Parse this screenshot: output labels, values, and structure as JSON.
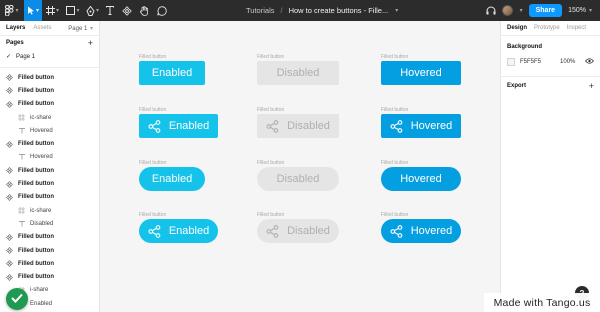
{
  "toolbar": {
    "breadcrumb_project": "Tutorials",
    "breadcrumb_sep": "/",
    "file_title": "How to create buttons - Fille...",
    "share_label": "Share",
    "zoom_label": "150%",
    "icons": [
      "figma-menu-icon",
      "move-tool-icon",
      "frame-tool-icon",
      "shape-tool-icon",
      "pen-tool-icon",
      "text-tool-icon",
      "component-tool-icon",
      "hand-tool-icon",
      "comment-tool-icon",
      "headphones-icon",
      "avatar",
      "share-button",
      "zoom-menu"
    ]
  },
  "left_panel": {
    "tab_layers": "Layers",
    "tab_assets": "Assets",
    "page_menu": "Page 1",
    "pages_title": "Pages",
    "add_symbol": "+",
    "current_page": "Page 1",
    "check_symbol": "✓",
    "layers": [
      {
        "label": "Filled button",
        "kind": "component"
      },
      {
        "label": "Filled button",
        "kind": "component"
      },
      {
        "label": "Filled button",
        "kind": "component"
      },
      {
        "label": "ic-share",
        "kind": "child-grid"
      },
      {
        "label": "Hovered",
        "kind": "child-text"
      },
      {
        "label": "Filled button",
        "kind": "component"
      },
      {
        "label": "Hovered",
        "kind": "child-text"
      },
      {
        "label": "Filled button",
        "kind": "component"
      },
      {
        "label": "Filled button",
        "kind": "component"
      },
      {
        "label": "Filled button",
        "kind": "component"
      },
      {
        "label": "ic-share",
        "kind": "child-grid"
      },
      {
        "label": "Disabled",
        "kind": "child-text"
      },
      {
        "label": "Filled button",
        "kind": "component"
      },
      {
        "label": "Filled button",
        "kind": "component"
      },
      {
        "label": "Filled button",
        "kind": "component"
      },
      {
        "label": "Filled button",
        "kind": "component"
      },
      {
        "label": "i-share",
        "kind": "child-grid"
      },
      {
        "label": "Enabled",
        "kind": "child-text"
      }
    ]
  },
  "canvas": {
    "frame_label": "Filled button",
    "buttons": [
      {
        "label": "Enabled",
        "state": "enabled",
        "icon": false,
        "shape": "rect"
      },
      {
        "label": "Disabled",
        "state": "disabled",
        "icon": false,
        "shape": "rect"
      },
      {
        "label": "Hovered",
        "state": "hovered",
        "icon": false,
        "shape": "rect"
      },
      {
        "label": "Enabled",
        "state": "enabled",
        "icon": true,
        "shape": "rect"
      },
      {
        "label": "Disabled",
        "state": "disabled",
        "icon": true,
        "shape": "rect"
      },
      {
        "label": "Hovered",
        "state": "hovered",
        "icon": true,
        "shape": "rect"
      },
      {
        "label": "Enabled",
        "state": "enabled",
        "icon": false,
        "shape": "pill"
      },
      {
        "label": "Disabled",
        "state": "disabled",
        "icon": false,
        "shape": "pill"
      },
      {
        "label": "Hovered",
        "state": "hovered",
        "icon": false,
        "shape": "pill"
      },
      {
        "label": "Enabled",
        "state": "enabled",
        "icon": true,
        "shape": "pill"
      },
      {
        "label": "Disabled",
        "state": "disabled",
        "icon": true,
        "shape": "pill"
      },
      {
        "label": "Hovered",
        "state": "hovered",
        "icon": true,
        "shape": "pill"
      }
    ],
    "colors": {
      "enabled": "#14c2ea",
      "disabled": "#e5e5e5",
      "hovered": "#049fe0",
      "canvas_bg": "#f5f5f5"
    }
  },
  "right_panel": {
    "tab_design": "Design",
    "tab_prototype": "Prototype",
    "tab_inspect": "Inspect",
    "background_title": "Background",
    "fill_hex": "F5F5F5",
    "fill_opacity": "100%",
    "export_title": "Export",
    "add_symbol": "+",
    "help_symbol": "?"
  },
  "overlay": {
    "watermark": "Made with Tango.us"
  }
}
